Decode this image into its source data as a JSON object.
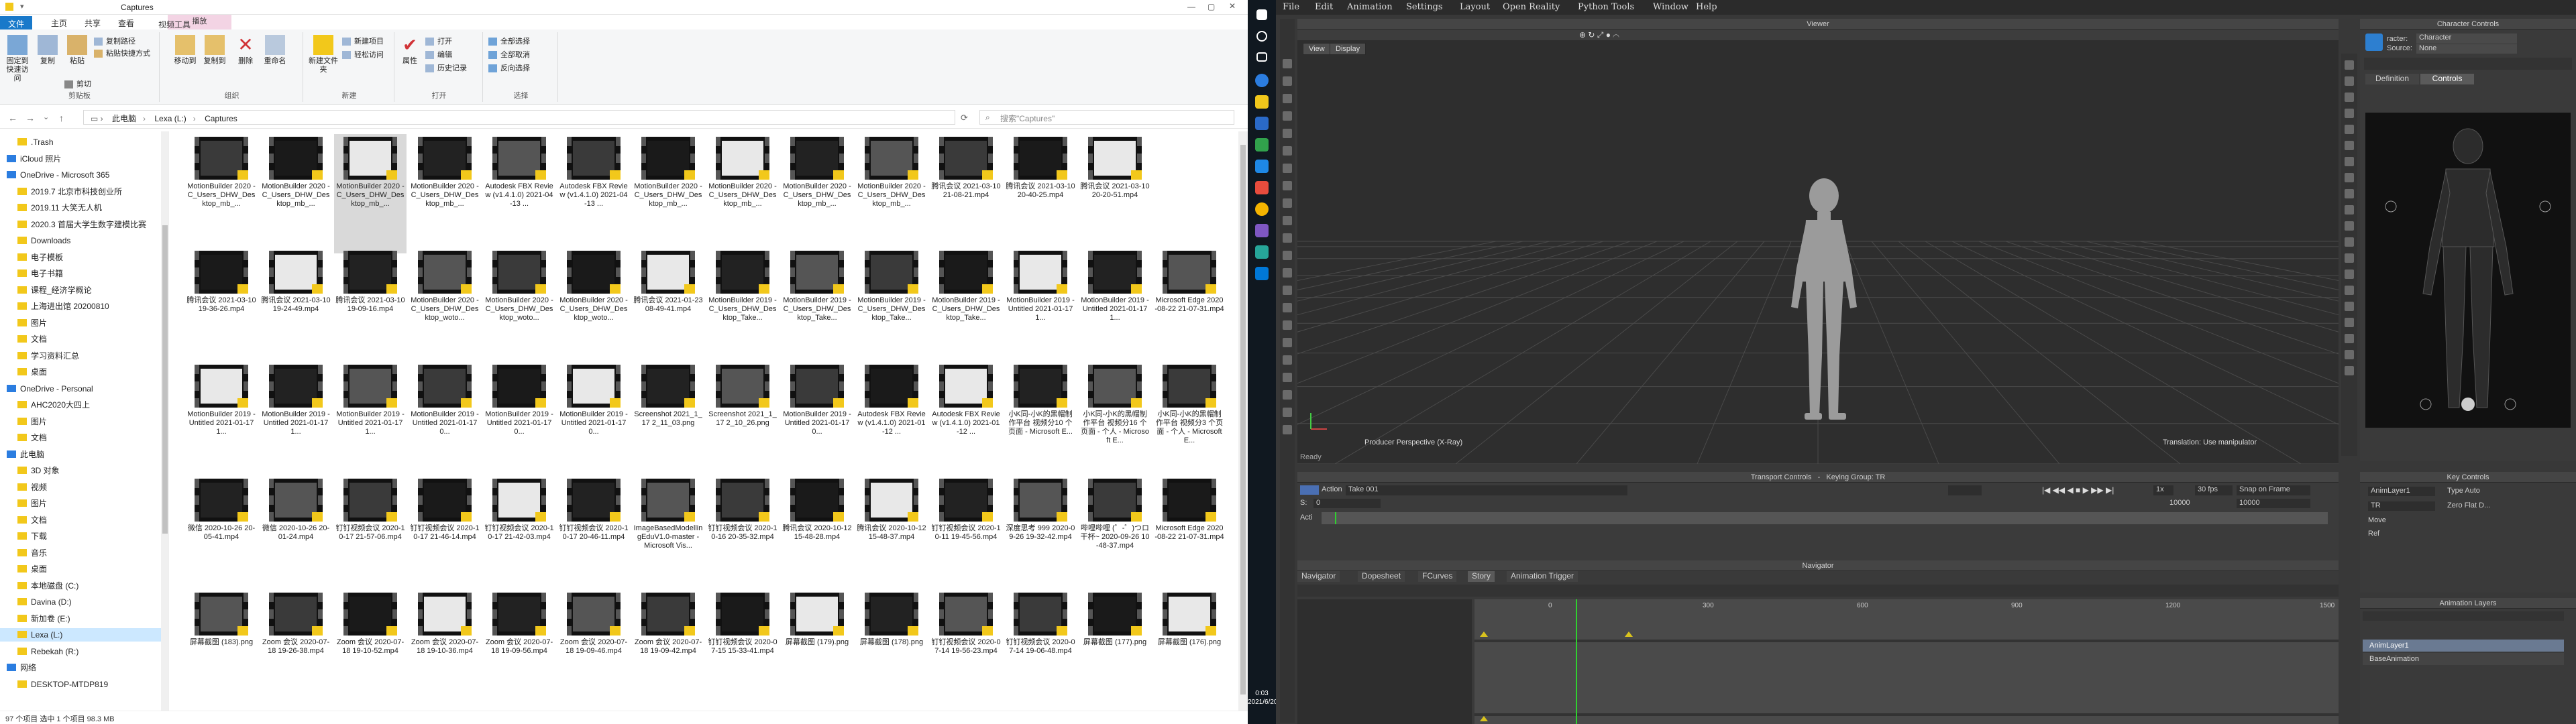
{
  "explorer": {
    "title": "Captures",
    "context_tab_label": "播放",
    "ribbon_tabs": [
      "文件",
      "主页",
      "共享",
      "查看",
      "视频工具"
    ],
    "ribbon": {
      "clipboard": {
        "pin": "固定到快速访问",
        "copy": "复制",
        "paste": "粘贴",
        "copy_path": "复制路径",
        "paste_shortcut": "粘贴快捷方式",
        "cut": "剪切",
        "label": "剪贴板"
      },
      "organize": {
        "move_to": "移动到",
        "copy_to": "复制到",
        "delete": "删除",
        "rename": "重命名",
        "label": "组织"
      },
      "new": {
        "new_folder": "新建文件夹",
        "new_item": "新建项目",
        "easy_access": "轻松访问",
        "label": "新建"
      },
      "open": {
        "properties": "属性",
        "open": "打开",
        "edit": "编辑",
        "history": "历史记录",
        "label": "打开"
      },
      "select": {
        "select_all": "全部选择",
        "select_none": "全部取消",
        "invert": "反向选择",
        "label": "选择"
      }
    },
    "breadcrumb": [
      "此电脑",
      "Lexa (L:)",
      "Captures"
    ],
    "search_placeholder": "搜索\"Captures\"",
    "nav_items": [
      {
        "label": ".Trash",
        "indent": 1
      },
      {
        "label": "iCloud 照片",
        "indent": 0
      },
      {
        "label": "OneDrive - Microsoft 365",
        "indent": 0
      },
      {
        "label": "2019.7 北京市科技创业所",
        "indent": 1
      },
      {
        "label": "2019.11 大笑无人机",
        "indent": 1
      },
      {
        "label": "2020.3 首届大学生数字建模比赛",
        "indent": 1
      },
      {
        "label": "Downloads",
        "indent": 1
      },
      {
        "label": "电子模板",
        "indent": 1
      },
      {
        "label": "电子书籍",
        "indent": 1
      },
      {
        "label": "课程_经济学概论",
        "indent": 1
      },
      {
        "label": "上海进出馆 20200810",
        "indent": 1
      },
      {
        "label": "图片",
        "indent": 1
      },
      {
        "label": "文档",
        "indent": 1
      },
      {
        "label": "学习资料汇总",
        "indent": 1
      },
      {
        "label": "桌面",
        "indent": 1
      },
      {
        "label": "OneDrive - Personal",
        "indent": 0
      },
      {
        "label": "AHC2020大四上",
        "indent": 1
      },
      {
        "label": "图片",
        "indent": 1
      },
      {
        "label": "文档",
        "indent": 1
      },
      {
        "label": "此电脑",
        "indent": 0
      },
      {
        "label": "3D 对象",
        "indent": 1
      },
      {
        "label": "视频",
        "indent": 1
      },
      {
        "label": "图片",
        "indent": 1
      },
      {
        "label": "文档",
        "indent": 1
      },
      {
        "label": "下载",
        "indent": 1
      },
      {
        "label": "音乐",
        "indent": 1
      },
      {
        "label": "桌面",
        "indent": 1
      },
      {
        "label": "本地磁盘 (C:)",
        "indent": 1
      },
      {
        "label": "Davina (D:)",
        "indent": 1
      },
      {
        "label": "新加卷 (E:)",
        "indent": 1
      },
      {
        "label": "Lexa (L:)",
        "indent": 1,
        "selected": true
      },
      {
        "label": "Rebekah (R:)",
        "indent": 1
      },
      {
        "label": "网络",
        "indent": 0
      },
      {
        "label": "DESKTOP-MTDP819",
        "indent": 1
      }
    ],
    "files": [
      [
        "MotionBuilder 2020 - C_Users_DHW_Desktop_mb_...",
        "MotionBuilder 2020 - C_Users_DHW_Desktop_mb_...",
        "MotionBuilder 2020 - C_Users_DHW_Desktop_mb_...",
        "MotionBuilder 2020 - C_Users_DHW_Desktop_mb_...",
        "Autodesk FBX Review (v1.4.1.0) 2021-04-13 ...",
        "Autodesk FBX Review (v1.4.1.0) 2021-04-13 ...",
        "MotionBuilder 2020 - C_Users_DHW_Desktop_mb_...",
        "MotionBuilder 2020 - C_Users_DHW_Desktop_mb_...",
        "MotionBuilder 2020 - C_Users_DHW_Desktop_mb_...",
        "MotionBuilder 2020 - C_Users_DHW_Desktop_mb_...",
        "腾讯会议 2021-03-10 21-08-21.mp4",
        "腾讯会议 2021-03-10 20-40-25.mp4",
        "腾讯会议 2021-03-10 20-20-51.mp4"
      ],
      [
        "腾讯会议 2021-03-10 19-36-26.mp4",
        "腾讯会议 2021-03-10 19-24-49.mp4",
        "腾讯会议 2021-03-10 19-09-16.mp4",
        "MotionBuilder 2020 - C_Users_DHW_Desktop_woto...",
        "MotionBuilder 2020 - C_Users_DHW_Desktop_woto...",
        "MotionBuilder 2020 - C_Users_DHW_Desktop_woto...",
        "腾讯会议 2021-01-23 08-49-41.mp4",
        "MotionBuilder 2019 - C_Users_DHW_Desktop_Take...",
        "MotionBuilder 2019 - C_Users_DHW_Desktop_Take...",
        "MotionBuilder 2019 - C_Users_DHW_Desktop_Take...",
        "MotionBuilder 2019 - C_Users_DHW_Desktop_Take...",
        "MotionBuilder 2019 - Untitled 2021-01-17 1...",
        "MotionBuilder 2019 - Untitled 2021-01-17 1..."
      ],
      [
        "MotionBuilder 2019 - Untitled 2021-01-17 1...",
        "MotionBuilder 2019 - Untitled 2021-01-17 1...",
        "MotionBuilder 2019 - Untitled 2021-01-17 1...",
        "MotionBuilder 2019 - Untitled 2021-01-17 0...",
        "MotionBuilder 2019 - Untitled 2021-01-17 0...",
        "MotionBuilder 2019 - Untitled 2021-01-17 0...",
        "Screenshot 2021_1_17 2_11_03.png",
        "Screenshot 2021_1_17 2_10_26.png",
        "MotionBuilder 2019 - Untitled 2021-01-17 0...",
        "Autodesk FBX Review (v1.4.1.0) 2021-01-12 ...",
        "Autodesk FBX Review (v1.4.1.0) 2021-01-12 ...",
        "小K同-小K的黑帽制作平台 视频分10 个页面 - Microsoft E...",
        "小K同-小K的黑帽制作平台 视频分16 个页面 - 个人 - Microsoft E..."
      ],
      [
        "微信 2020-10-26 20-05-41.mp4",
        "微信 2020-10-26 20-01-24.mp4",
        "钉钉视频会议 2020-10-17 21-57-06.mp4",
        "钉钉视频会议 2020-10-17 21-46-14.mp4",
        "钉钉视频会议 2020-10-17 21-42-03.mp4",
        "钉钉视频会议 2020-10-17 20-46-11.mp4",
        "ImageBasedModellingEduV1.0-master - Microsoft Vis...",
        "钉钉视频会议 2020-10-16 20-35-32.mp4",
        "腾讯会议 2020-10-12 15-48-28.mp4",
        "腾讯会议 2020-10-12 15-48-37.mp4",
        "钉钉视频会议 2020-10-11 19-45-56.mp4",
        "深度思考 999 2020-09-26 19-32-42.mp4",
        "哔哩哔哩 (゜-゜)つロ 干杯~ 2020-09-26 10-48-37.mp4"
      ],
      [
        "屏幕截图 (183).png",
        "Zoom 会议 2020-07-18 19-26-38.mp4",
        "Zoom 会议 2020-07-18 19-10-52.mp4",
        "Zoom 会议 2020-07-18 19-10-36.mp4",
        "Zoom 会议 2020-07-18 19-09-56.mp4",
        "Zoom 会议 2020-07-18 19-09-46.mp4",
        "Zoom 会议 2020-07-18 19-09-42.mp4",
        "钉钉视频会议 2020-07-15 15-33-41.mp4",
        "屏幕截图 (179).png",
        "屏幕截图 (178).png",
        "钉钉视频会议 2020-07-14 19-56-23.mp4",
        "钉钉视频会议 2020-07-14 19-06-48.mp4",
        "屏幕截图 (177).png"
      ]
    ],
    "extra_tiles": {
      "row2": "Microsoft Edge 2020-08-22 21-07-31.mp4",
      "row3": "小K同-小K的黑帽制作平台 视频分3 个页面 - 个人 - Microsoft E...",
      "row4": "Microsoft Edge 2020-08-22 21-07-31.mp4",
      "row5": "屏幕截图 (176).png"
    },
    "status": "97 个项目   选中 1 个项目  98.3 MB"
  },
  "taskbar": {
    "time": "0:03",
    "date": "2021/6/20"
  },
  "motionbuilder": {
    "menu": [
      "File",
      "Edit",
      "Animation",
      "Settings",
      "Layout",
      "Open Reality",
      "Python Tools",
      "Window",
      "Help"
    ],
    "viewer_title": "Viewer",
    "view_button": "View",
    "display_button": "Display",
    "viewport_left_label": "Producer Perspective (X-Ray)",
    "viewport_right_label": "Translation: Use manipulator",
    "ready": "Ready",
    "char_controls_title": "Character Controls",
    "character_label": "racter:",
    "character_value": "Character",
    "source_label": "Source:",
    "source_value": "None",
    "tab_definition": "Definition",
    "tab_controls": "Controls",
    "transport_title": "Transport Controls",
    "keying_group": "Keying Group: TR",
    "take_label": "Action",
    "take_value": "Take 001",
    "end_frame": "10000",
    "end_frame_2": "10000",
    "start_value": "0",
    "fps": "30 fps",
    "snap": "Snap on Frame",
    "speed": "1x",
    "acti_label": "Acti",
    "navigator_title": "Navigator",
    "nav_tabs": [
      "Navigator",
      "Dopesheet",
      "FCurves",
      "Story",
      "Animation Trigger"
    ],
    "key_controls_title": "Key Controls",
    "anim_layer_field": "AnimLayer1",
    "key_type": "Type Auto",
    "tr_label": "TR",
    "interp": "Zero Flat D...",
    "move_label": "Move",
    "ref_label": "Ref",
    "anim_layers_title": "Animation Layers",
    "layers": [
      "AnimLayer1",
      "BaseAnimation"
    ],
    "timeline_ticks": [
      "0",
      "300",
      "600",
      "900",
      "1200",
      "1500"
    ]
  },
  "colors": {
    "accent": "#1979ca",
    "selection": "#cce8ff",
    "mb_bg": "#383838",
    "mb_green": "#2fd12f",
    "mb_yellow": "#d8c21e"
  }
}
